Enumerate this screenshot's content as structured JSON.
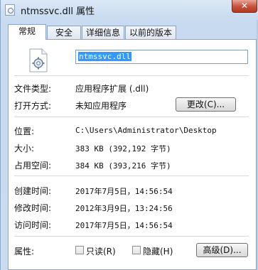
{
  "window": {
    "title": "ntmssvc.dll 属性",
    "close_glyph": "✕"
  },
  "tabs": [
    {
      "label": "常规",
      "active": true
    },
    {
      "label": "安全",
      "active": false
    },
    {
      "label": "详细信息",
      "active": false
    },
    {
      "label": "以前的版本",
      "active": false
    }
  ],
  "general": {
    "file_name": "ntmssvc.dll",
    "file_icon": "dll-file-icon",
    "file_type_label": "文件类型:",
    "file_type_value": "应用程序扩展 (.dll)",
    "open_with_label": "打开方式:",
    "open_with_value": "未知应用程序",
    "change_button": "更改(C)...",
    "location_label": "位置:",
    "location_value": "C:\\Users\\Administrator\\Desktop",
    "size_label": "大小:",
    "size_value": "383 KB (392,192 字节)",
    "size_on_disk_label": "占用空间:",
    "size_on_disk_value": "384 KB (393,216 字节)",
    "created_label": "创建时间:",
    "created_value": "2017年7月5日，14:56:54",
    "modified_label": "修改时间:",
    "modified_value": "2012年3月9日，13:24:56",
    "accessed_label": "访问时间:",
    "accessed_value": "2017年7月5日，14:56:54",
    "attributes_label": "属性:",
    "readonly_label": "只读(R)",
    "readonly_checked": false,
    "hidden_label": "隐藏(H)",
    "hidden_checked": false,
    "advanced_button": "高级(D)..."
  }
}
